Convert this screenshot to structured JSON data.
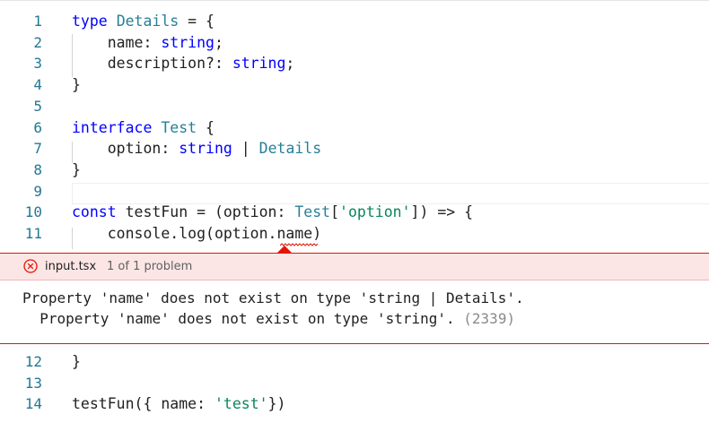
{
  "code_lines_top": [
    {
      "num": "1",
      "tokens": [
        {
          "t": "type",
          "c": "kw"
        },
        {
          "t": " "
        },
        {
          "t": "Details",
          "c": "ty"
        },
        {
          "t": " = {"
        }
      ]
    },
    {
      "num": "2",
      "tokens": [
        {
          "t": "    name: "
        },
        {
          "t": "string",
          "c": "kw"
        },
        {
          "t": ";"
        }
      ]
    },
    {
      "num": "3",
      "tokens": [
        {
          "t": "    description?: "
        },
        {
          "t": "string",
          "c": "kw"
        },
        {
          "t": ";"
        }
      ]
    },
    {
      "num": "4",
      "tokens": [
        {
          "t": "}"
        }
      ]
    },
    {
      "num": "5",
      "tokens": []
    },
    {
      "num": "6",
      "tokens": [
        {
          "t": "interface",
          "c": "kw"
        },
        {
          "t": " "
        },
        {
          "t": "Test",
          "c": "ty"
        },
        {
          "t": " {"
        }
      ]
    },
    {
      "num": "7",
      "tokens": [
        {
          "t": "    option: "
        },
        {
          "t": "string",
          "c": "kw"
        },
        {
          "t": " | "
        },
        {
          "t": "Details",
          "c": "ty"
        }
      ]
    },
    {
      "num": "8",
      "tokens": [
        {
          "t": "}"
        }
      ]
    },
    {
      "num": "9",
      "tokens": []
    },
    {
      "num": "10",
      "tokens": [
        {
          "t": "const",
          "c": "kw"
        },
        {
          "t": " testFun = (option: "
        },
        {
          "t": "Test",
          "c": "ty"
        },
        {
          "t": "["
        },
        {
          "t": "'option'",
          "c": "strg"
        },
        {
          "t": "]) => {"
        }
      ]
    },
    {
      "num": "11",
      "tokens": [
        {
          "t": "    console.log(option.name)"
        }
      ]
    }
  ],
  "peek": {
    "file": "input.tsx",
    "count": "1 of 1 problem",
    "message_line1": "Property 'name' does not exist on type 'string | Details'.",
    "message_line2": "  Property 'name' does not exist on type 'string'.",
    "error_code": "(2339)",
    "error_icon": "error-circle-icon"
  },
  "code_lines_bottom": [
    {
      "num": "12",
      "tokens": [
        {
          "t": "}"
        }
      ]
    },
    {
      "num": "13",
      "tokens": []
    },
    {
      "num": "14",
      "tokens": [
        {
          "t": "testFun({ name: "
        },
        {
          "t": "'test'",
          "c": "strg"
        },
        {
          "t": "})"
        }
      ]
    }
  ],
  "colors": {
    "keyword": "#0000ff",
    "type": "#267f99",
    "string": "#098658",
    "line_number": "#237893",
    "error": "#e51400",
    "peek_header_bg": "#fbe5e5"
  }
}
